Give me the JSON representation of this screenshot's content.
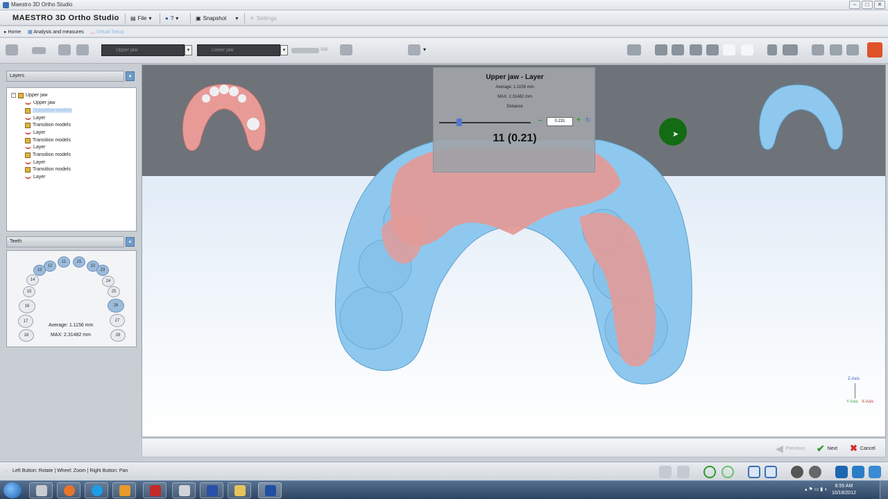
{
  "window": {
    "title": "Maestro 3D Ortho Studio"
  },
  "menubar": {
    "brand": "MAESTRO 3D Ortho Studio",
    "file": "File",
    "help": "?",
    "snapshot": "Snapshot",
    "settings": "Settings"
  },
  "breadcrumb": [
    "Home",
    "Analysis and measures",
    "Virtual Setup"
  ],
  "toolbar": {
    "upper_jaw_combo": "Upper jaw",
    "lower_jaw_combo": "Lower jaw",
    "icon_text": "333"
  },
  "layers_panel": {
    "title": "Layers",
    "root": "Upper jaw",
    "items": [
      {
        "label": "Upper jaw",
        "type": "jaw"
      },
      {
        "label": "Transition models",
        "type": "box",
        "selected": true
      },
      {
        "label": "Layer",
        "type": "jaw"
      },
      {
        "label": "Transition models",
        "type": "box"
      },
      {
        "label": "Layer",
        "type": "jaw"
      },
      {
        "label": "Transition models",
        "type": "box"
      },
      {
        "label": "Layer",
        "type": "jaw"
      },
      {
        "label": "Transition models",
        "type": "box"
      },
      {
        "label": "Layer",
        "type": "jaw"
      },
      {
        "label": "Transition models",
        "type": "box"
      },
      {
        "label": "Layer",
        "type": "jaw"
      }
    ]
  },
  "teeth_panel": {
    "title": "Teeth",
    "teeth": [
      "12",
      "11",
      "21",
      "22",
      "13",
      "23",
      "14",
      "24",
      "15",
      "25",
      "16",
      "26",
      "17",
      "27",
      "18",
      "28"
    ],
    "average": "Average: 1.1156 mm",
    "max": "MAX: 2.31482 mm"
  },
  "popup": {
    "title": "Upper jaw - Layer",
    "average": "Average: 1.1156 mm",
    "max": "MAX: 2.31482 mm",
    "distance_label": "Distance",
    "distance_value": "0.231",
    "distance_slider_fraction": 0.22,
    "big_value": "11 (0.21)"
  },
  "axes": {
    "z": "Z-Axis",
    "y": "Y-Axis",
    "x": "X-Axis"
  },
  "nav": {
    "previous": "Previous",
    "next": "Next",
    "cancel": "Cancel"
  },
  "statusbar": {
    "hint": "Left Button: Rotate | Wheel: Zoom | Right Button: Pan"
  },
  "taskbar": {
    "time": "8:55 AM",
    "date": "10/18/2012"
  },
  "colors": {
    "upper_jaw": "#e89a97",
    "lower_jaw": "#8ec8ee",
    "accent": "#6f9bc9"
  }
}
